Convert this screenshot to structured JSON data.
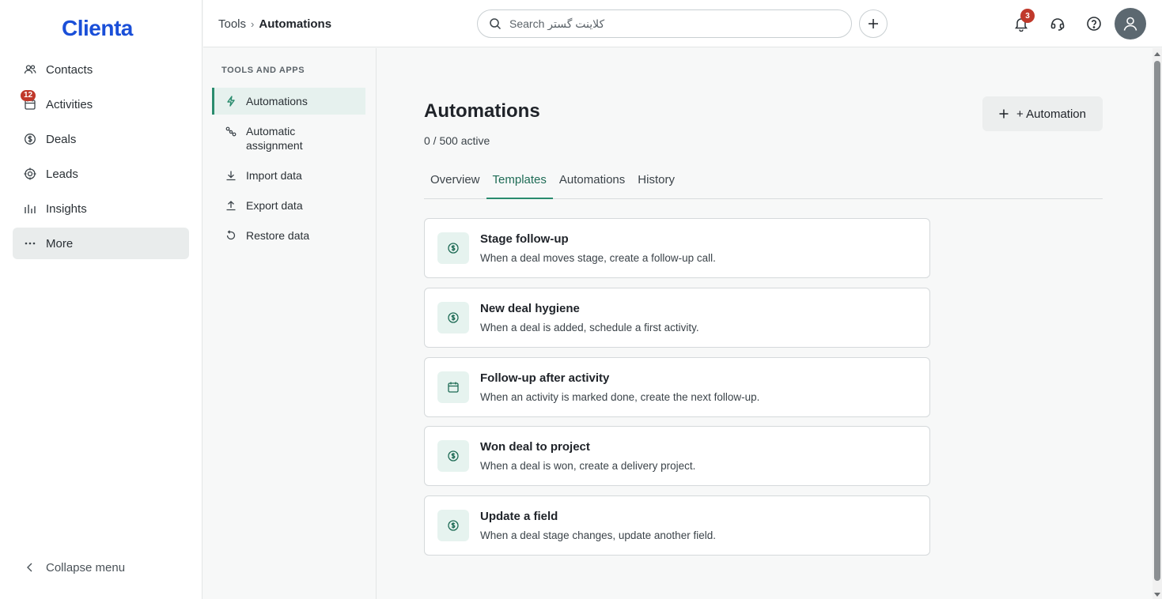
{
  "app": {
    "logo": "Clienta",
    "brand_color": "#1a4fd8",
    "accent_color": "#2a8c6e"
  },
  "nav": {
    "items": [
      {
        "label": "Contacts",
        "icon": "contacts-icon"
      },
      {
        "label": "Activities",
        "icon": "calendar-icon",
        "badge": "12"
      },
      {
        "label": "Deals",
        "icon": "dollar-icon"
      },
      {
        "label": "Leads",
        "icon": "target-icon"
      },
      {
        "label": "Insights",
        "icon": "bar-chart-icon"
      },
      {
        "label": "More",
        "icon": "more-icon",
        "active": true
      }
    ],
    "collapse_label": "Collapse menu"
  },
  "topbar": {
    "breadcrumb": {
      "parent": "Tools",
      "separator": "›",
      "current": "Automations"
    },
    "search": {
      "placeholder": "Search کلاینت گستر",
      "value": ""
    },
    "notifications_badge": "3"
  },
  "subnav": {
    "heading": "TOOLS AND APPS",
    "items": [
      {
        "label": "Automations",
        "icon": "bolt-icon",
        "active": true
      },
      {
        "label": "Automatic assignment",
        "icon": "share-icon"
      },
      {
        "label": "Import data",
        "icon": "download-icon"
      },
      {
        "label": "Export data",
        "icon": "upload-icon"
      },
      {
        "label": "Restore data",
        "icon": "restore-icon"
      }
    ]
  },
  "main": {
    "title": "Automations",
    "subtitle": "0 / 500 active",
    "add_button": "+ Automation",
    "tabs": [
      {
        "label": "Overview"
      },
      {
        "label": "Templates",
        "active": true
      },
      {
        "label": "Automations"
      },
      {
        "label": "History"
      }
    ],
    "templates": [
      {
        "title": "Stage follow-up",
        "description": "When a deal moves stage, create a follow-up call.",
        "icon": "dollar-icon"
      },
      {
        "title": "New deal hygiene",
        "description": "When a deal is added, schedule a first activity.",
        "icon": "dollar-icon"
      },
      {
        "title": "Follow-up after activity",
        "description": "When an activity is marked done, create the next follow-up.",
        "icon": "calendar-icon"
      },
      {
        "title": "Won deal to project",
        "description": "When a deal is won, create a delivery project.",
        "icon": "dollar-icon"
      },
      {
        "title": "Update a field",
        "description": "When a deal stage changes, update another field.",
        "icon": "dollar-icon"
      }
    ]
  }
}
